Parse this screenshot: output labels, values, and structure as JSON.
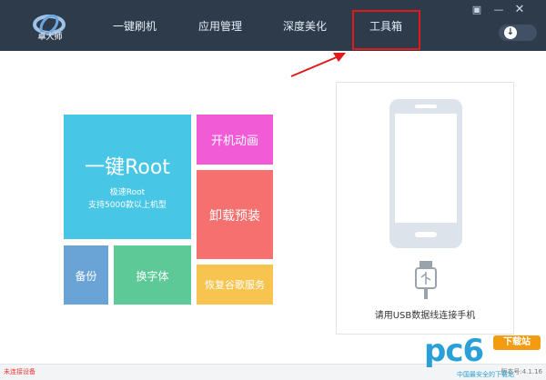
{
  "app": {
    "logo_text": "卓大师"
  },
  "nav": {
    "items": [
      {
        "label": "一键刷机"
      },
      {
        "label": "应用管理"
      },
      {
        "label": "深度美化"
      },
      {
        "label": "工具箱"
      }
    ],
    "highlighted_item": "工具箱"
  },
  "tiles": {
    "root": {
      "title": "一键Root",
      "line1": "极速Root",
      "line2": "支持5000款以上机型"
    },
    "boot_animation": {
      "label": "开机动画"
    },
    "uninstall_preinstalled": {
      "label": "卸载预装"
    },
    "backup": {
      "label": "备份"
    },
    "change_font": {
      "label": "换字体"
    },
    "restore_google": {
      "label": "恢复谷歌服务"
    }
  },
  "phone_panel": {
    "hint": "请用USB数据线连接手机"
  },
  "statusbar": {
    "connection_status": "未连接设备",
    "version": "版本号:4.1.16"
  },
  "watermark": {
    "main": "pc6",
    "badge": "下载站",
    "sub": "中国最安全的下载站"
  },
  "colors": {
    "header_bg": "#2e3b4b",
    "highlight_border": "#e31818",
    "root_tile": "#47c6e5",
    "animation_tile": "#f15bd5",
    "uninstall_tile": "#f5706e",
    "backup_tile": "#6aa4d6",
    "font_tile": "#5cc996",
    "google_tile": "#f6c44f"
  }
}
